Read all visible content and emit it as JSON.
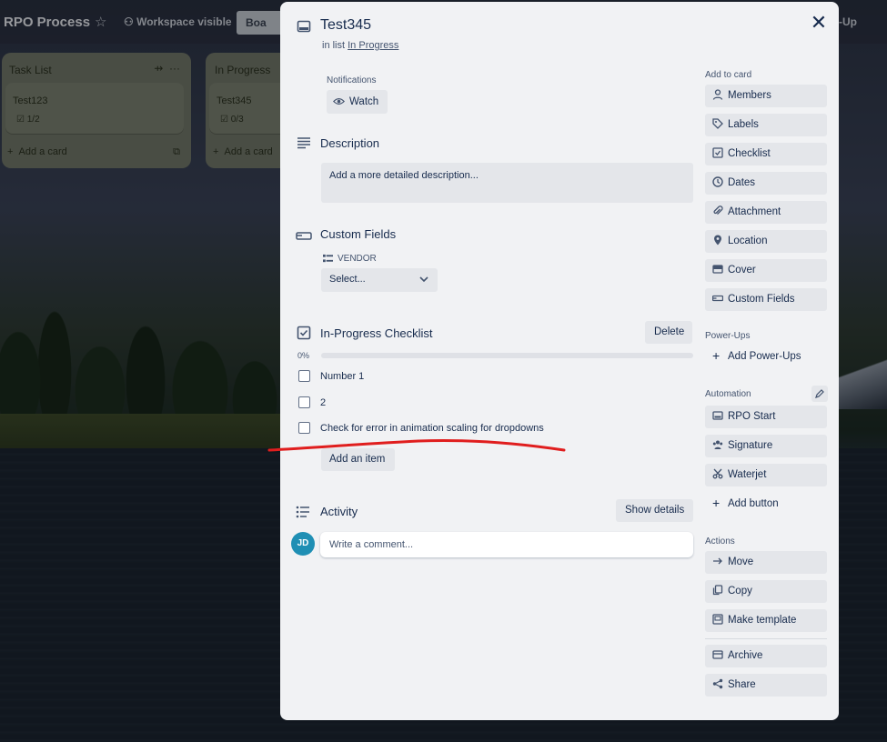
{
  "board": {
    "title": "RPO Process",
    "workspace_visible": "Workspace visible",
    "board_button": "Boa",
    "right_partial": "-Up"
  },
  "lists": [
    {
      "title": "Task List",
      "card_title": "Test123",
      "card_badge": "1/2",
      "add_card": "Add a card"
    },
    {
      "title": "In Progress",
      "card_title": "Test345",
      "card_badge": "0/3",
      "add_card": "Add a card"
    }
  ],
  "card": {
    "title": "Test345",
    "in_list_prefix": "in list",
    "in_list_name": "In Progress",
    "notifications_label": "Notifications",
    "watch_label": "Watch",
    "description": {
      "title": "Description",
      "placeholder": "Add a more detailed description..."
    },
    "custom_fields": {
      "title": "Custom Fields",
      "field_label": "VENDOR",
      "select_value": "Select..."
    },
    "checklist": {
      "title": "In-Progress Checklist",
      "delete_label": "Delete",
      "percent": "0%",
      "progress": 0,
      "items": [
        {
          "text": "Number 1",
          "checked": false
        },
        {
          "text": "2",
          "checked": false
        },
        {
          "text": "Check for error in animation scaling for dropdowns",
          "checked": false
        }
      ],
      "add_item_label": "Add an item"
    },
    "activity": {
      "title": "Activity",
      "show_details": "Show details",
      "comment_placeholder": "Write a comment...",
      "avatar_initials": "JD"
    }
  },
  "sidebar": {
    "add_to_card_label": "Add to card",
    "add_to_card": [
      "Members",
      "Labels",
      "Checklist",
      "Dates",
      "Attachment",
      "Location",
      "Cover",
      "Custom Fields"
    ],
    "powerups_label": "Power-Ups",
    "add_powerups": "Add Power-Ups",
    "automation_label": "Automation",
    "automation": [
      "RPO Start",
      "Signature",
      "Waterjet"
    ],
    "add_button": "Add button",
    "actions_label": "Actions",
    "actions": [
      "Move",
      "Copy",
      "Make template"
    ],
    "more_actions": [
      "Archive",
      "Share"
    ]
  },
  "colors": {
    "modal_bg": "#f1f2f4",
    "button_bg": "#e4e6ea",
    "text": "#172b4d",
    "annotation_red": "#e01e1e"
  }
}
